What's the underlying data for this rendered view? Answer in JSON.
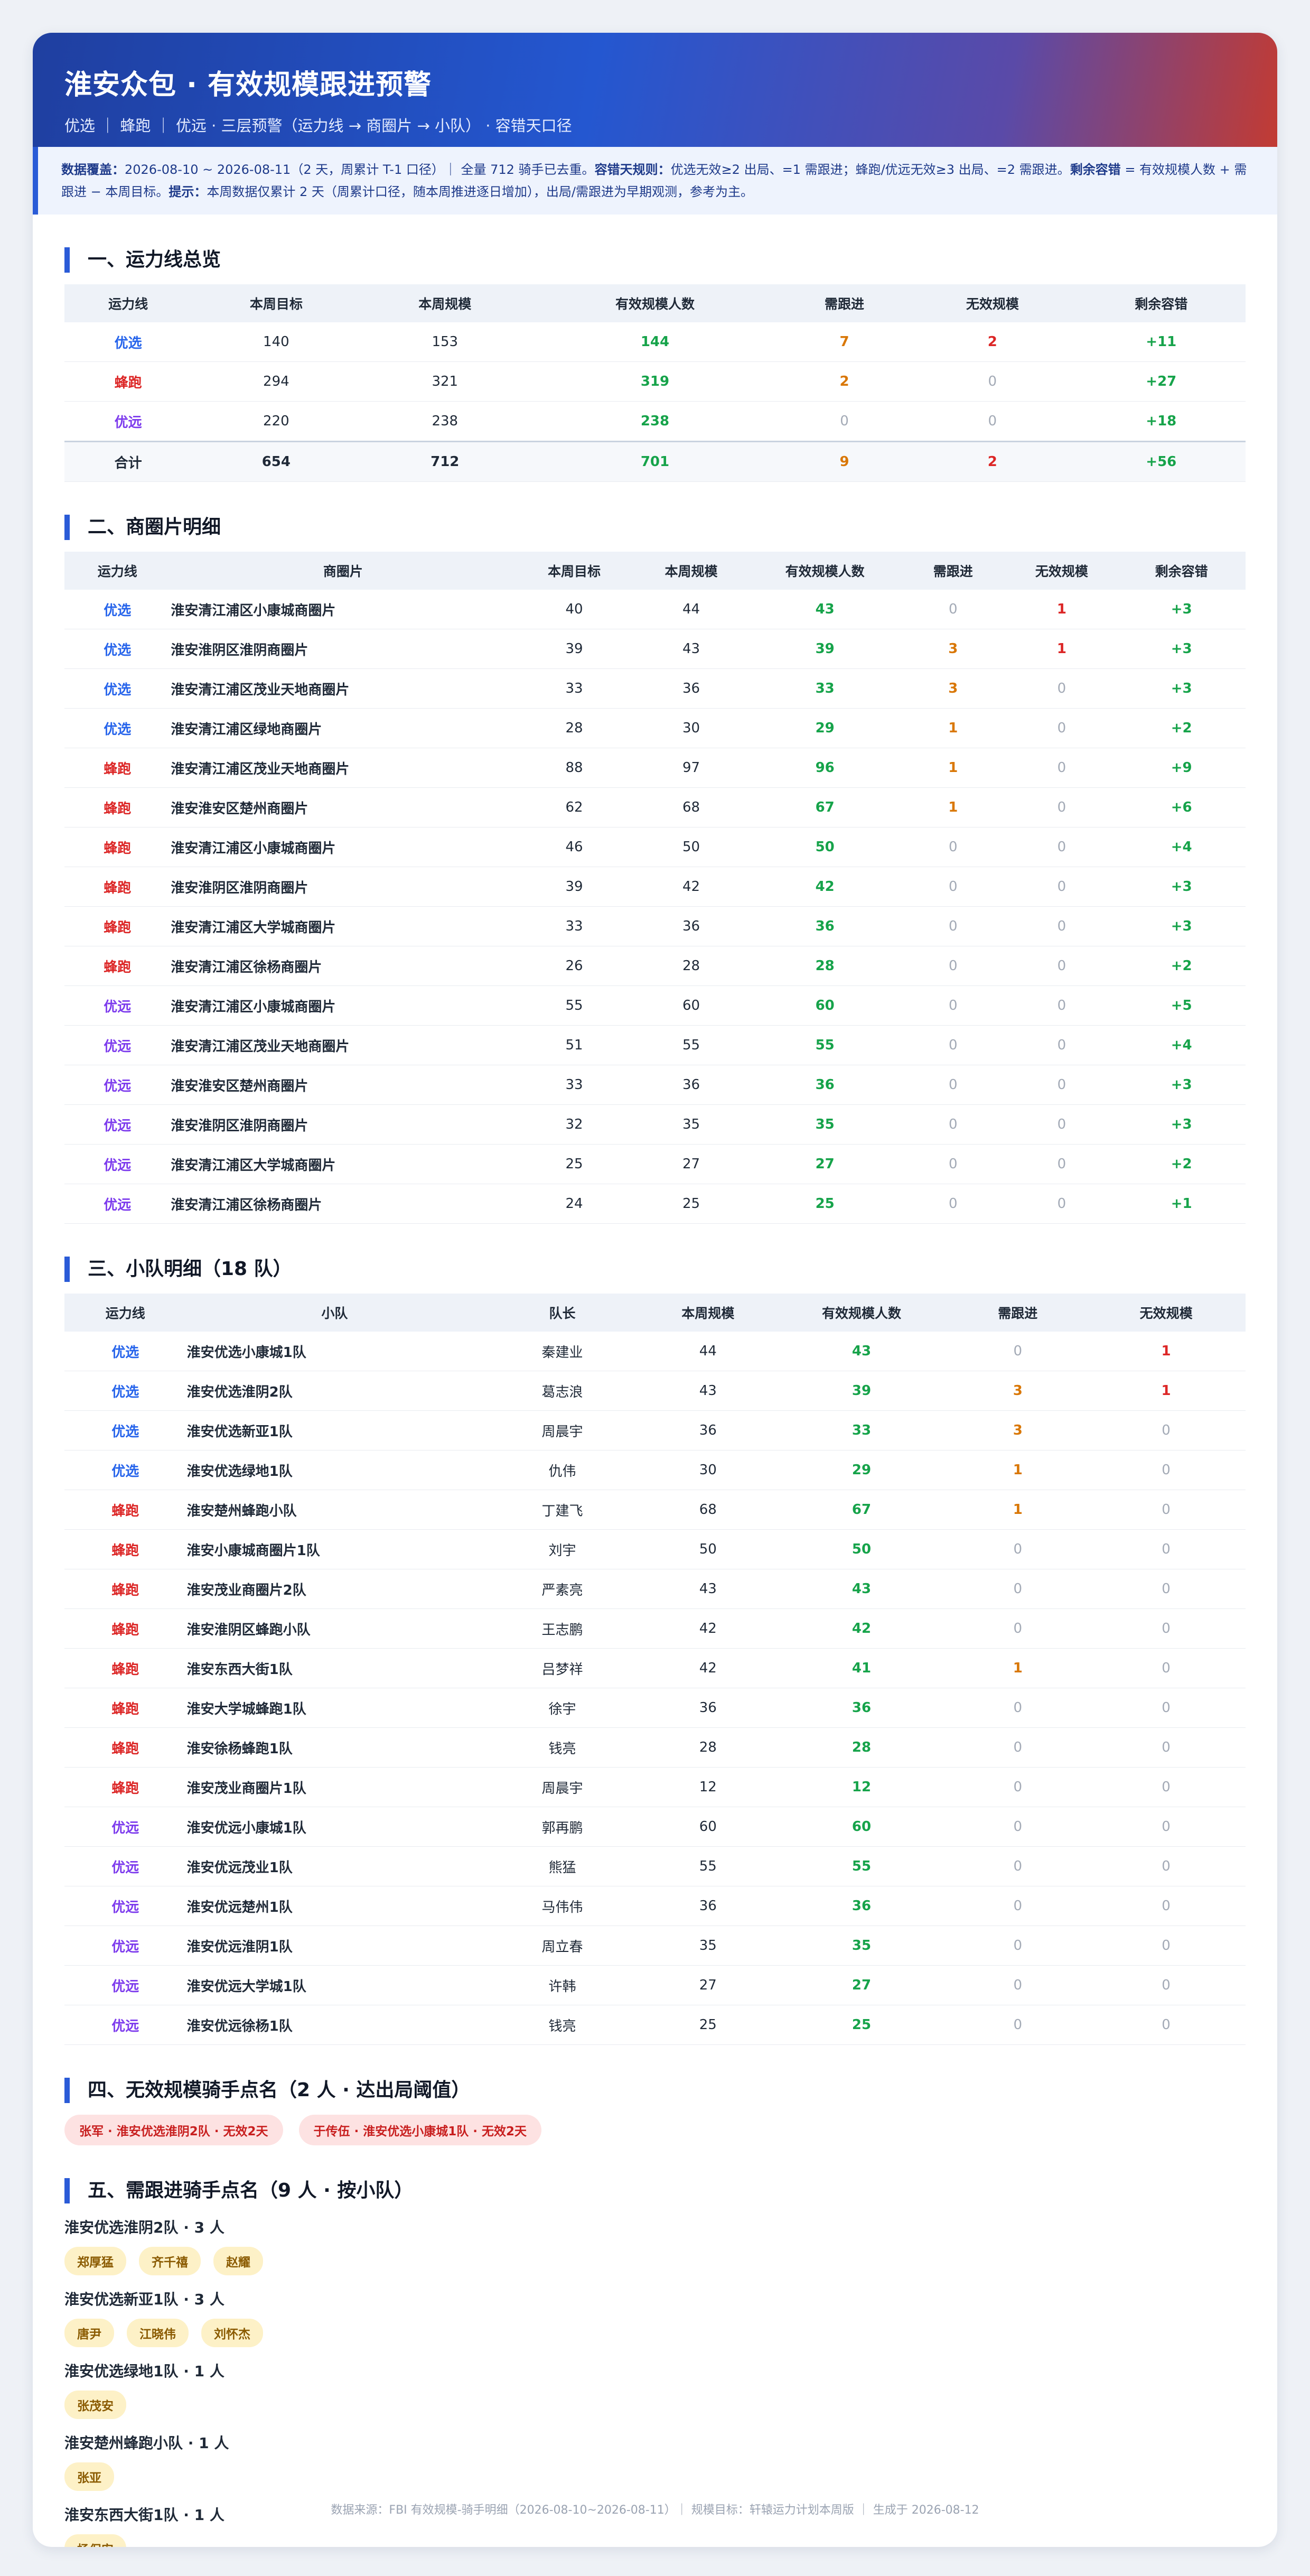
{
  "header": {
    "title": "淮安众包 · 有效规模跟进预警",
    "subtitle": "优选 ｜ 蜂跑 ｜ 优远   ·   三层预警（运力线 → 商圈片 → 小队）   ·   容错天口径"
  },
  "notice": {
    "coverage_label": "数据覆盖：",
    "coverage_text": "2026-08-10 ~ 2026-08-11（2 天，周累计 T-1 口径）｜ 全量 712 骑手已去重。",
    "rule_label": "容错天规则：",
    "rule_text": "优选无效≥2 出局、=1 需跟进；蜂跑/优远无效≥3 出局、=2 需跟进。",
    "margin_label": "剩余容错",
    "margin_text": " = 有效规模人数 + 需跟进 − 本周目标。",
    "tip_label": "提示：",
    "tip_text": "本周数据仅累计 2 天（周累计口径，随本周推进逐日增加），出局/需跟进为早期观测，参考为主。"
  },
  "section1": {
    "title": "一、运力线总览",
    "headers": [
      "运力线",
      "本周目标",
      "本周规模",
      "有效规模人数",
      "需跟进",
      "无效规模",
      "剩余容错"
    ],
    "rows": [
      {
        "line": "优选",
        "cls": "c-youxuan",
        "target": "140",
        "scale": "153",
        "effective": "144",
        "follow": "7",
        "invalid": "2",
        "margin": "+11"
      },
      {
        "line": "蜂跑",
        "cls": "c-fengpao",
        "target": "294",
        "scale": "321",
        "effective": "319",
        "follow": "2",
        "invalid": "0",
        "margin": "+27"
      },
      {
        "line": "优远",
        "cls": "c-youyuan",
        "target": "220",
        "scale": "238",
        "effective": "238",
        "follow": "0",
        "invalid": "0",
        "margin": "+18"
      }
    ],
    "total": {
      "line": "合计",
      "target": "654",
      "scale": "712",
      "effective": "701",
      "follow": "9",
      "invalid": "2",
      "margin": "+56"
    }
  },
  "section2": {
    "title": "二、商圈片明细",
    "headers": [
      "运力线",
      "商圈片",
      "本周目标",
      "本周规模",
      "有效规模人数",
      "需跟进",
      "无效规模",
      "剩余容错"
    ],
    "rows": [
      {
        "line": "优选",
        "cls": "c-youxuan",
        "area": "淮安清江浦区小康城商圈片",
        "target": "40",
        "scale": "44",
        "effective": "43",
        "follow": "0",
        "invalid": "1",
        "margin": "+3"
      },
      {
        "line": "优选",
        "cls": "c-youxuan",
        "area": "淮安淮阴区淮阴商圈片",
        "target": "39",
        "scale": "43",
        "effective": "39",
        "follow": "3",
        "invalid": "1",
        "margin": "+3"
      },
      {
        "line": "优选",
        "cls": "c-youxuan",
        "area": "淮安清江浦区茂业天地商圈片",
        "target": "33",
        "scale": "36",
        "effective": "33",
        "follow": "3",
        "invalid": "0",
        "margin": "+3"
      },
      {
        "line": "优选",
        "cls": "c-youxuan",
        "area": "淮安清江浦区绿地商圈片",
        "target": "28",
        "scale": "30",
        "effective": "29",
        "follow": "1",
        "invalid": "0",
        "margin": "+2"
      },
      {
        "line": "蜂跑",
        "cls": "c-fengpao",
        "area": "淮安清江浦区茂业天地商圈片",
        "target": "88",
        "scale": "97",
        "effective": "96",
        "follow": "1",
        "invalid": "0",
        "margin": "+9"
      },
      {
        "line": "蜂跑",
        "cls": "c-fengpao",
        "area": "淮安淮安区楚州商圈片",
        "target": "62",
        "scale": "68",
        "effective": "67",
        "follow": "1",
        "invalid": "0",
        "margin": "+6"
      },
      {
        "line": "蜂跑",
        "cls": "c-fengpao",
        "area": "淮安清江浦区小康城商圈片",
        "target": "46",
        "scale": "50",
        "effective": "50",
        "follow": "0",
        "invalid": "0",
        "margin": "+4"
      },
      {
        "line": "蜂跑",
        "cls": "c-fengpao",
        "area": "淮安淮阴区淮阴商圈片",
        "target": "39",
        "scale": "42",
        "effective": "42",
        "follow": "0",
        "invalid": "0",
        "margin": "+3"
      },
      {
        "line": "蜂跑",
        "cls": "c-fengpao",
        "area": "淮安清江浦区大学城商圈片",
        "target": "33",
        "scale": "36",
        "effective": "36",
        "follow": "0",
        "invalid": "0",
        "margin": "+3"
      },
      {
        "line": "蜂跑",
        "cls": "c-fengpao",
        "area": "淮安清江浦区徐杨商圈片",
        "target": "26",
        "scale": "28",
        "effective": "28",
        "follow": "0",
        "invalid": "0",
        "margin": "+2"
      },
      {
        "line": "优远",
        "cls": "c-youyuan",
        "area": "淮安清江浦区小康城商圈片",
        "target": "55",
        "scale": "60",
        "effective": "60",
        "follow": "0",
        "invalid": "0",
        "margin": "+5"
      },
      {
        "line": "优远",
        "cls": "c-youyuan",
        "area": "淮安清江浦区茂业天地商圈片",
        "target": "51",
        "scale": "55",
        "effective": "55",
        "follow": "0",
        "invalid": "0",
        "margin": "+4"
      },
      {
        "line": "优远",
        "cls": "c-youyuan",
        "area": "淮安淮安区楚州商圈片",
        "target": "33",
        "scale": "36",
        "effective": "36",
        "follow": "0",
        "invalid": "0",
        "margin": "+3"
      },
      {
        "line": "优远",
        "cls": "c-youyuan",
        "area": "淮安淮阴区淮阴商圈片",
        "target": "32",
        "scale": "35",
        "effective": "35",
        "follow": "0",
        "invalid": "0",
        "margin": "+3"
      },
      {
        "line": "优远",
        "cls": "c-youyuan",
        "area": "淮安清江浦区大学城商圈片",
        "target": "25",
        "scale": "27",
        "effective": "27",
        "follow": "0",
        "invalid": "0",
        "margin": "+2"
      },
      {
        "line": "优远",
        "cls": "c-youyuan",
        "area": "淮安清江浦区徐杨商圈片",
        "target": "24",
        "scale": "25",
        "effective": "25",
        "follow": "0",
        "invalid": "0",
        "margin": "+1"
      }
    ]
  },
  "section3": {
    "title": "三、小队明细（18 队）",
    "headers": [
      "运力线",
      "小队",
      "队长",
      "本周规模",
      "有效规模人数",
      "需跟进",
      "无效规模"
    ],
    "rows": [
      {
        "line": "优选",
        "cls": "c-youxuan",
        "team": "淮安优选小康城1队",
        "leader": "秦建业",
        "scale": "44",
        "effective": "43",
        "follow": "0",
        "invalid": "1"
      },
      {
        "line": "优选",
        "cls": "c-youxuan",
        "team": "淮安优选淮阴2队",
        "leader": "葛志浪",
        "scale": "43",
        "effective": "39",
        "follow": "3",
        "invalid": "1"
      },
      {
        "line": "优选",
        "cls": "c-youxuan",
        "team": "淮安优选新亚1队",
        "leader": "周晨宇",
        "scale": "36",
        "effective": "33",
        "follow": "3",
        "invalid": "0"
      },
      {
        "line": "优选",
        "cls": "c-youxuan",
        "team": "淮安优选绿地1队",
        "leader": "仇伟",
        "scale": "30",
        "effective": "29",
        "follow": "1",
        "invalid": "0"
      },
      {
        "line": "蜂跑",
        "cls": "c-fengpao",
        "team": "淮安楚州蜂跑小队",
        "leader": "丁建飞",
        "scale": "68",
        "effective": "67",
        "follow": "1",
        "invalid": "0"
      },
      {
        "line": "蜂跑",
        "cls": "c-fengpao",
        "team": "淮安小康城商圈片1队",
        "leader": "刘宇",
        "scale": "50",
        "effective": "50",
        "follow": "0",
        "invalid": "0"
      },
      {
        "line": "蜂跑",
        "cls": "c-fengpao",
        "team": "淮安茂业商圈片2队",
        "leader": "严素亮",
        "scale": "43",
        "effective": "43",
        "follow": "0",
        "invalid": "0"
      },
      {
        "line": "蜂跑",
        "cls": "c-fengpao",
        "team": "淮安淮阴区蜂跑小队",
        "leader": "王志鹏",
        "scale": "42",
        "effective": "42",
        "follow": "0",
        "invalid": "0"
      },
      {
        "line": "蜂跑",
        "cls": "c-fengpao",
        "team": "淮安东西大街1队",
        "leader": "吕梦祥",
        "scale": "42",
        "effective": "41",
        "follow": "1",
        "invalid": "0"
      },
      {
        "line": "蜂跑",
        "cls": "c-fengpao",
        "team": "淮安大学城蜂跑1队",
        "leader": "徐宇",
        "scale": "36",
        "effective": "36",
        "follow": "0",
        "invalid": "0"
      },
      {
        "line": "蜂跑",
        "cls": "c-fengpao",
        "team": "淮安徐杨蜂跑1队",
        "leader": "钱亮",
        "scale": "28",
        "effective": "28",
        "follow": "0",
        "invalid": "0"
      },
      {
        "line": "蜂跑",
        "cls": "c-fengpao",
        "team": "淮安茂业商圈片1队",
        "leader": "周晨宇",
        "scale": "12",
        "effective": "12",
        "follow": "0",
        "invalid": "0"
      },
      {
        "line": "优远",
        "cls": "c-youyuan",
        "team": "淮安优远小康城1队",
        "leader": "郭再鹏",
        "scale": "60",
        "effective": "60",
        "follow": "0",
        "invalid": "0"
      },
      {
        "line": "优远",
        "cls": "c-youyuan",
        "team": "淮安优远茂业1队",
        "leader": "熊猛",
        "scale": "55",
        "effective": "55",
        "follow": "0",
        "invalid": "0"
      },
      {
        "line": "优远",
        "cls": "c-youyuan",
        "team": "淮安优远楚州1队",
        "leader": "马伟伟",
        "scale": "36",
        "effective": "36",
        "follow": "0",
        "invalid": "0"
      },
      {
        "line": "优远",
        "cls": "c-youyuan",
        "team": "淮安优远淮阴1队",
        "leader": "周立春",
        "scale": "35",
        "effective": "35",
        "follow": "0",
        "invalid": "0"
      },
      {
        "line": "优远",
        "cls": "c-youyuan",
        "team": "淮安优远大学城1队",
        "leader": "许韩",
        "scale": "27",
        "effective": "27",
        "follow": "0",
        "invalid": "0"
      },
      {
        "line": "优远",
        "cls": "c-youyuan",
        "team": "淮安优远徐杨1队",
        "leader": "钱亮",
        "scale": "25",
        "effective": "25",
        "follow": "0",
        "invalid": "0"
      }
    ]
  },
  "section4": {
    "title": "四、无效规模骑手点名（2 人 · 达出局阈值）",
    "pills": [
      "张军 · 淮安优选淮阴2队 · 无效2天",
      "于传伍 · 淮安优选小康城1队 · 无效2天"
    ]
  },
  "section5": {
    "title": "五、需跟进骑手点名（9 人 · 按小队）",
    "groups": [
      {
        "title": "淮安优选淮阴2队 · 3 人",
        "names": [
          "郑厚猛",
          "齐千禧",
          "赵耀"
        ]
      },
      {
        "title": "淮安优选新亚1队 · 3 人",
        "names": [
          "唐尹",
          "江晓伟",
          "刘怀杰"
        ]
      },
      {
        "title": "淮安优选绿地1队 · 1 人",
        "names": [
          "张茂安"
        ]
      },
      {
        "title": "淮安楚州蜂跑小队 · 1 人",
        "names": [
          "张亚"
        ]
      },
      {
        "title": "淮安东西大街1队 · 1 人",
        "names": [
          "杨保安"
        ]
      }
    ]
  },
  "footer": {
    "text": "数据来源：FBI 有效规模-骑手明细（2026-08-10~2026-08-11）｜ 规模目标：轩辕运力计划本周版 ｜ 生成于 2026-08-12"
  }
}
